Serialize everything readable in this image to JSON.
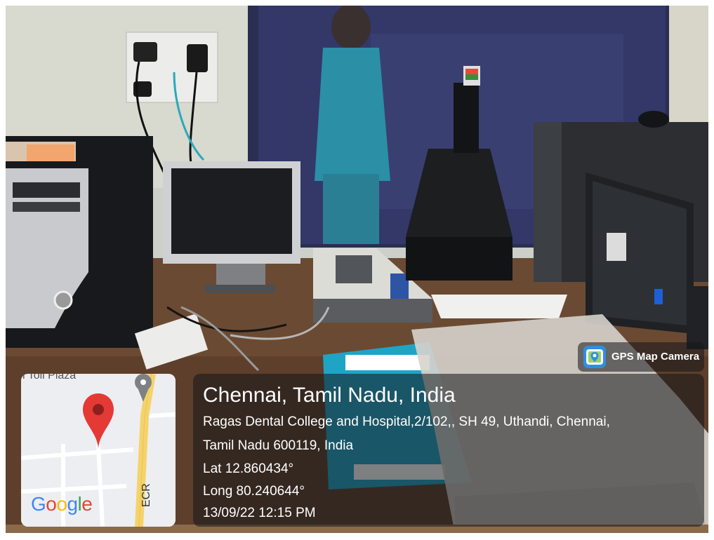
{
  "map": {
    "corner_text": "l Toll Plaza",
    "road_label": "ECR",
    "logo": [
      "G",
      "o",
      "o",
      "g",
      "l",
      "e"
    ],
    "logo_colors": [
      "#4285F4",
      "#EA4335",
      "#FBBC05",
      "#4285F4",
      "#34A853",
      "#EA4335"
    ],
    "pin_color": "#E53935",
    "road_color": "#F5D36B",
    "icon": "map-pin-icon"
  },
  "location": {
    "title": "Chennai, Tamil Nadu, India",
    "address_line1": "Ragas Dental College and Hospital,2/102,, SH 49, Uthandi, Chennai,",
    "address_line2": "Tamil Nadu 600119, India",
    "latitude": "Lat 12.860434°",
    "longitude": "Long 80.240644°",
    "datetime": "13/09/22 12:15 PM"
  },
  "badge": {
    "label": "GPS Map Camera",
    "icon": "gps-map-camera-icon"
  },
  "colors": {
    "overlay": "#14161a",
    "text": "#ffffff"
  }
}
